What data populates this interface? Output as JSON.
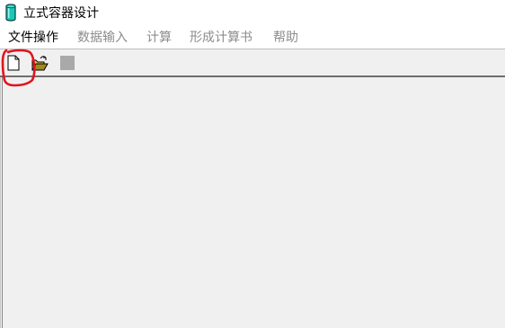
{
  "window": {
    "title": "立式容器设计",
    "icon": "app-cylinder-icon"
  },
  "menu": {
    "items": [
      {
        "label": "文件操作",
        "enabled": true
      },
      {
        "label": "数据输入",
        "enabled": false
      },
      {
        "label": "计算",
        "enabled": false
      },
      {
        "label": "形成计算书",
        "enabled": false
      },
      {
        "label": "帮助",
        "enabled": false
      }
    ]
  },
  "toolbar": {
    "buttons": [
      {
        "icon": "new-file-icon",
        "enabled": true
      },
      {
        "icon": "open-folder-icon",
        "enabled": true
      },
      {
        "icon": "stop-icon",
        "enabled": false
      }
    ]
  },
  "annotation": {
    "color": "#e0141e",
    "target": "new-file-button"
  },
  "colors": {
    "menu_disabled": "#8c8c8c",
    "app_icon": "#18c8b8",
    "client_bg": "#f0f0f0"
  }
}
